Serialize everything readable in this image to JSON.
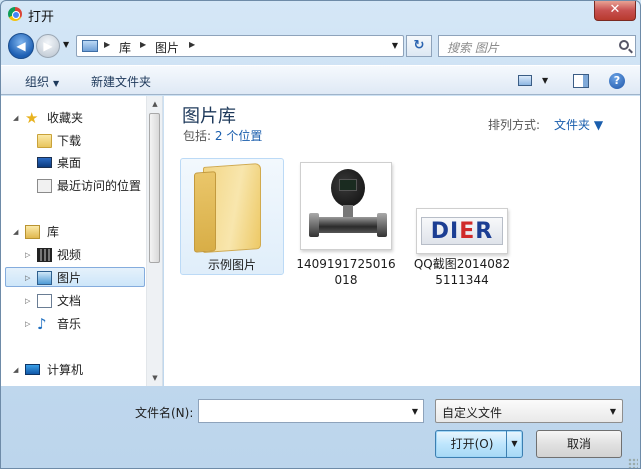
{
  "window": {
    "title": "打开",
    "close_label": "✕"
  },
  "address_bar": {
    "breadcrumbs": [
      "库",
      "图片"
    ],
    "separator": "▶",
    "dropdown_glyph": "▼",
    "refresh_glyph": "↻"
  },
  "search": {
    "placeholder": "搜索 图片"
  },
  "nav_buttons": {
    "back_glyph": "◀",
    "forward_glyph": "▶",
    "history_glyph": "▼"
  },
  "toolbar": {
    "organize_label": "组织",
    "organize_caret": "▼",
    "new_folder_label": "新建文件夹",
    "view_caret": "▼",
    "help_label": "?"
  },
  "nav_pane": {
    "favorites": {
      "label": "收藏夹",
      "items": [
        "下载",
        "桌面",
        "最近访问的位置"
      ]
    },
    "libraries": {
      "label": "库",
      "items": [
        "视频",
        "图片",
        "文档",
        "音乐"
      ],
      "selected": "图片"
    },
    "computer": {
      "label": "计算机"
    },
    "scroll_up": "▲",
    "scroll_down": "▼",
    "expanded_glyph": "◢",
    "collapsed_glyph": "▷"
  },
  "content": {
    "library_title": "图片库",
    "includes_label": "包括:",
    "includes_link": "2 个位置",
    "arrange_label": "排列方式:",
    "arrange_value": "文件夹 ▼",
    "items": [
      {
        "label": "示例图片",
        "kind": "folder"
      },
      {
        "label": "1409191725016018",
        "kind": "image"
      },
      {
        "label": "QQ截图20140825111344",
        "kind": "image"
      }
    ],
    "logo_text_blue": "DI",
    "logo_text_red": "E",
    "logo_text_blue2": "R"
  },
  "bottom": {
    "filename_label": "文件名(N):",
    "filename_value": "",
    "filename_drop": "▼",
    "filetype_value": "自定义文件",
    "filetype_drop": "▼",
    "open_label": "打开(O)",
    "open_split": "▼",
    "cancel_label": "取消"
  }
}
